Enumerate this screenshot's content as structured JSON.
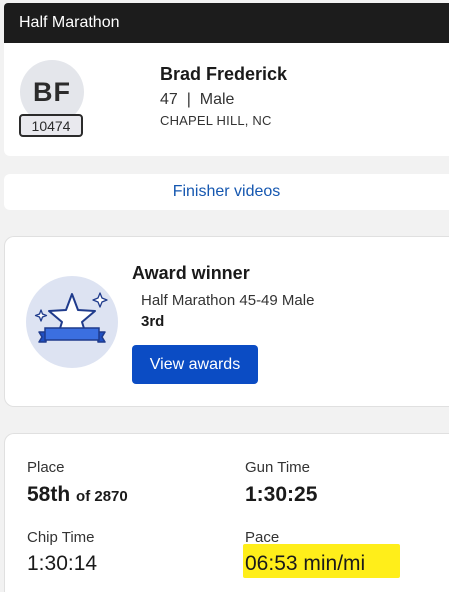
{
  "header": {
    "title": "Half Marathon"
  },
  "profile": {
    "initials": "BF",
    "bib": "10474",
    "name": "Brad Frederick",
    "age_sex": "47  |  Male",
    "location": "CHAPEL HILL, NC"
  },
  "videos": {
    "label": "Finisher videos"
  },
  "award": {
    "title": "Award winner",
    "category": "Half Marathon 45-49 Male",
    "place": "3rd",
    "button_label": "View awards",
    "badge_icon": "star-ribbon-icon"
  },
  "stats": {
    "place_label": "Place",
    "place_value": "58th",
    "place_total": "of 2870",
    "gun_time_label": "Gun Time",
    "gun_time_value": "1:30:25",
    "chip_time_label": "Chip Time",
    "chip_time_value": "1:30:14",
    "pace_label": "Pace",
    "pace_value": "06:53 min/mi"
  },
  "colors": {
    "header_bg": "#1c1c1c",
    "link": "#1557b0",
    "button_bg": "#0b4cc4",
    "highlight": "#ffee1a"
  }
}
